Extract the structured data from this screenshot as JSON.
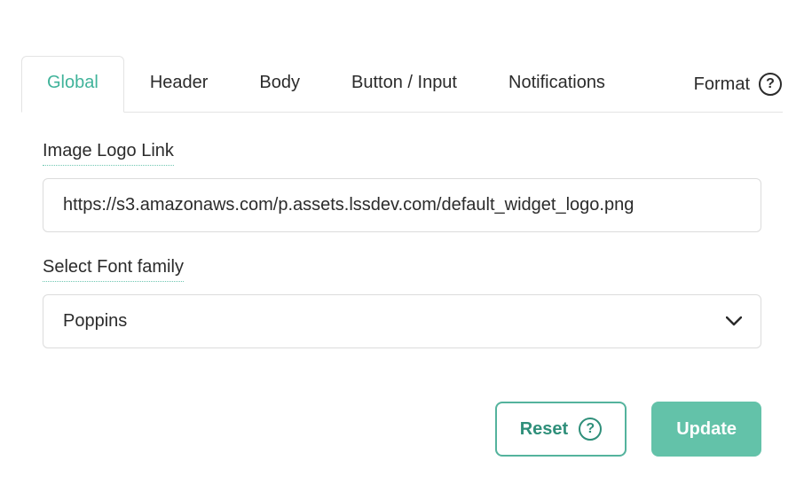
{
  "tabs": {
    "global": "Global",
    "header": "Header",
    "body": "Body",
    "button_input": "Button / Input",
    "notifications": "Notifications",
    "format": "Format"
  },
  "fields": {
    "logo_label": "Image Logo Link",
    "logo_value": "https://s3.amazonaws.com/p.assets.lssdev.com/default_widget_logo.png",
    "font_label": "Select Font family",
    "font_value": "Poppins"
  },
  "actions": {
    "reset": "Reset",
    "update": "Update"
  },
  "icons": {
    "help": "?"
  }
}
